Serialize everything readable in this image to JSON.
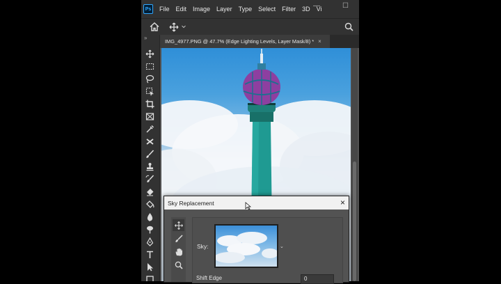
{
  "app": {
    "logo": "Ps",
    "menu": [
      "File",
      "Edit",
      "Image",
      "Layer",
      "Type",
      "Select",
      "Filter",
      "3D",
      "Vi"
    ],
    "window_controls": {
      "minimize": "—",
      "maximize": "☐"
    }
  },
  "options_bar": {
    "home_icon": "home-icon",
    "move_icon": "move-icon",
    "search_icon": "search-icon"
  },
  "document": {
    "tab_title": "IMG_4977.PNG @ 47.7% (Edge Lighting Levels, Layer Mask/8) *",
    "tab_close": "×"
  },
  "toolbar": {
    "tools": [
      "move-tool",
      "marquee-tool",
      "lasso-tool",
      "object-selection-tool",
      "crop-tool",
      "frame-tool",
      "eyedropper-tool",
      "healing-tool",
      "brush-tool",
      "clone-stamp-tool",
      "history-brush-tool",
      "eraser-tool",
      "paint-bucket-tool",
      "blur-tool",
      "dodge-tool",
      "pen-tool",
      "type-tool",
      "path-selection-tool",
      "rectangle-tool"
    ]
  },
  "dialog": {
    "title": "Sky Replacement",
    "close": "×",
    "sky_label": "Sky:",
    "sky_dropdown_caret": "⌄",
    "shift_edge_label": "Shift Edge",
    "shift_edge_value": "0",
    "tools": [
      "move-sky-tool",
      "sky-brush-tool",
      "hand-tool",
      "zoom-tool"
    ]
  },
  "colors": {
    "app_bg": "#535353",
    "panel_bg": "#323232",
    "accent": "#31a8ff",
    "tower": "#1f9a92",
    "dome": "#8e3fa0"
  }
}
